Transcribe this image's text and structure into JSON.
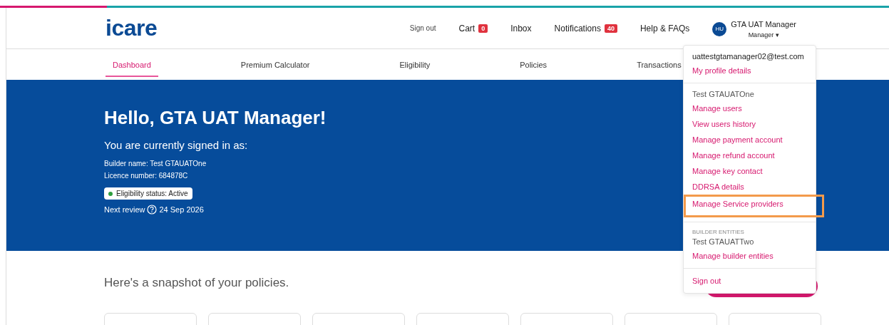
{
  "header": {
    "logo": "icare",
    "links": [
      {
        "kind": "small",
        "label": "Sign out"
      },
      {
        "kind": "badge",
        "label": "Cart",
        "badge": "0"
      },
      {
        "kind": "plain",
        "label": "Inbox"
      },
      {
        "kind": "badge",
        "label": "Notifications",
        "badge": "40"
      },
      {
        "kind": "plain",
        "label": "Help & FAQs"
      }
    ],
    "user": {
      "initials": "HU",
      "name": "GTA UAT Manager",
      "role": "Manager",
      "caret": "▾"
    }
  },
  "nav": [
    {
      "label": "Dashboard",
      "selected": true
    },
    {
      "label": "Premium Calculator",
      "selected": false
    },
    {
      "label": "Eligibility",
      "selected": false
    },
    {
      "label": "Policies",
      "selected": false
    },
    {
      "label": "Transactions",
      "selected": false
    }
  ],
  "hero": {
    "greeting": "Hello, GTA UAT Manager!",
    "signed_in": "You are currently signed in as:",
    "builder_name": "Builder name: Test GTAUATOne",
    "licence": "Licence number: 684878C",
    "status": {
      "label": "Eligibility status: Active",
      "color": "#2e9e3e"
    },
    "review_label": "Next review",
    "review_date": "24 Sep 2026"
  },
  "snapshot": {
    "title": "Here's a snapshot of your policies."
  },
  "menu": [
    {
      "items": [
        {
          "kind": "text",
          "label": "uattestgtamanager02@test.com"
        },
        {
          "kind": "link",
          "label": "My profile details",
          "highlighted": false
        }
      ]
    },
    {
      "items": [
        {
          "kind": "text",
          "label": "Test GTAUATOne"
        },
        {
          "kind": "link",
          "label": "Manage users",
          "highlighted": false
        },
        {
          "kind": "link",
          "label": "View users history",
          "highlighted": false
        },
        {
          "kind": "link",
          "label": "Manage payment account",
          "highlighted": false
        },
        {
          "kind": "link",
          "label": "Manage refund account",
          "highlighted": false
        },
        {
          "kind": "link",
          "label": "Manage key contact",
          "highlighted": false
        },
        {
          "kind": "link",
          "label": "DDRSA details",
          "highlighted": false
        },
        {
          "kind": "link",
          "label": "Manage Service providers",
          "highlighted": true
        }
      ]
    },
    {
      "items": [
        {
          "kind": "heading",
          "label": "BUILDER ENTITIES"
        },
        {
          "kind": "text",
          "label": "Test GTAUATTwo"
        },
        {
          "kind": "link",
          "label": "Manage builder entities",
          "highlighted": false
        }
      ]
    },
    {
      "items": [
        {
          "kind": "link",
          "label": "Sign out",
          "highlighted": false
        }
      ]
    }
  ]
}
